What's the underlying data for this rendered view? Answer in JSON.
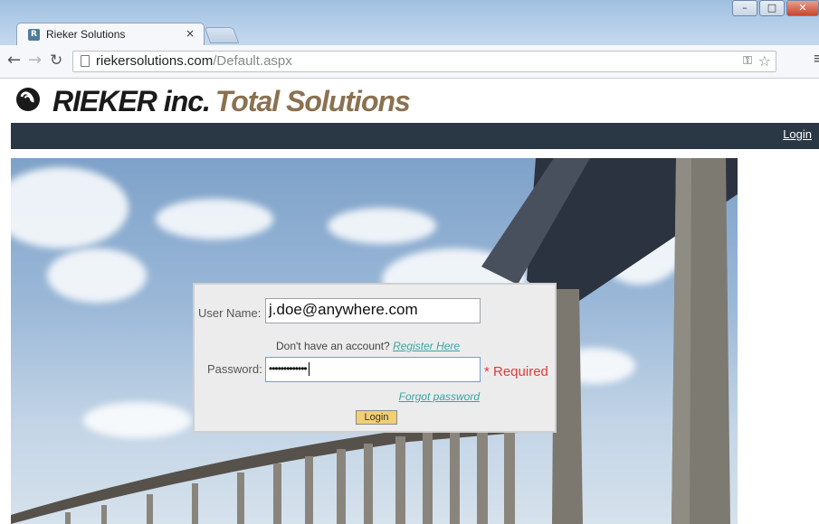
{
  "browser": {
    "tab_title": "Rieker Solutions",
    "tab_close": "×",
    "url_domain": "riekersolutions.com",
    "url_path": "/Default.aspx"
  },
  "site": {
    "brand": "RIEKER inc.",
    "tagline": "Total Solutions",
    "nav_login": "Login"
  },
  "login_form": {
    "username_label": "User Name:",
    "username_value": "j.doe@anywhere.com",
    "signup_prompt": "Don't have an account?",
    "register_link": "Register Here",
    "password_label": "Password:",
    "password_value": "•••••••••••••",
    "required_text": "* Required",
    "forgot_link": "Forgot password",
    "login_button": "Login"
  },
  "colors": {
    "navbar": "#2a3744",
    "tagline": "#8a7150",
    "link": "#3aa3a3",
    "required": "#e03a3a",
    "button": "#f1cf73"
  }
}
